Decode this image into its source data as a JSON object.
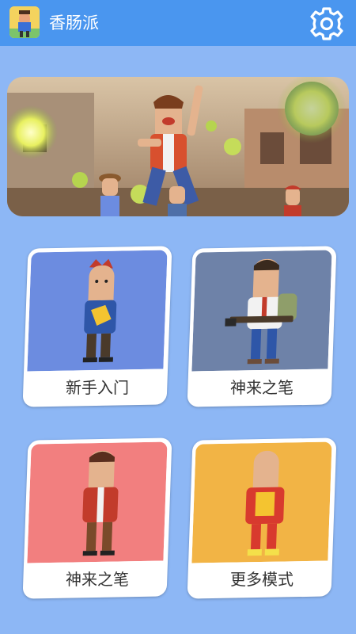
{
  "app": {
    "title": "香肠派",
    "icon": "app-logo-icon",
    "settings_icon": "gear-icon"
  },
  "colors": {
    "appbar": "#4A96EF",
    "background": "#8DB7F5",
    "card_blue": "#6C8CE0",
    "card_slate": "#6E82A8",
    "card_red": "#F27F7F",
    "card_gold": "#F2B445"
  },
  "banner": {
    "description_icon": "game-banner-image"
  },
  "cards": [
    {
      "label": "新手入门",
      "art_color": "#6C8CE0"
    },
    {
      "label": "神来之笔",
      "art_color": "#6E82A8"
    },
    {
      "label": "神来之笔",
      "art_color": "#F27F7F"
    },
    {
      "label": "更多模式",
      "art_color": "#F2B445"
    }
  ]
}
